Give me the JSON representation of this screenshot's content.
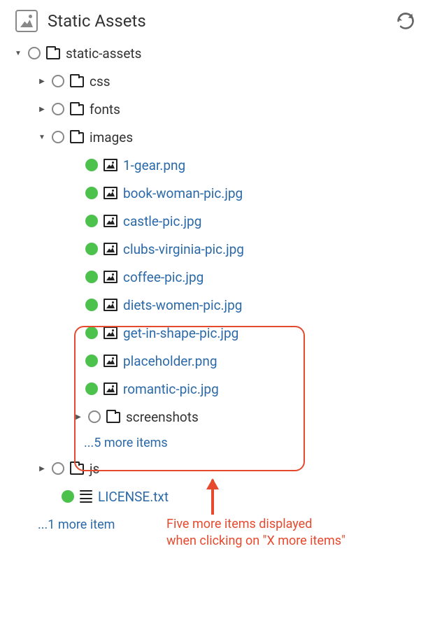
{
  "header": {
    "title": "Static Assets"
  },
  "tree": {
    "root": {
      "label": "static-assets"
    },
    "css": {
      "label": "css"
    },
    "fonts": {
      "label": "fonts"
    },
    "images": {
      "label": "images",
      "items": [
        "1-gear.png",
        "book-woman-pic.jpg",
        "castle-pic.jpg",
        "clubs-virginia-pic.jpg",
        "coffee-pic.jpg",
        "diets-women-pic.jpg",
        "get-in-shape-pic.jpg",
        "placeholder.png",
        "romantic-pic.jpg"
      ],
      "subfolder": "screenshots",
      "more": "...5 more items"
    },
    "js": {
      "label": "js"
    },
    "license": {
      "label": "LICENSE.txt"
    },
    "rootMore": "...1 more item"
  },
  "annotation": {
    "line1": "Five more items displayed",
    "line2": "when clicking on \"X more items\""
  }
}
